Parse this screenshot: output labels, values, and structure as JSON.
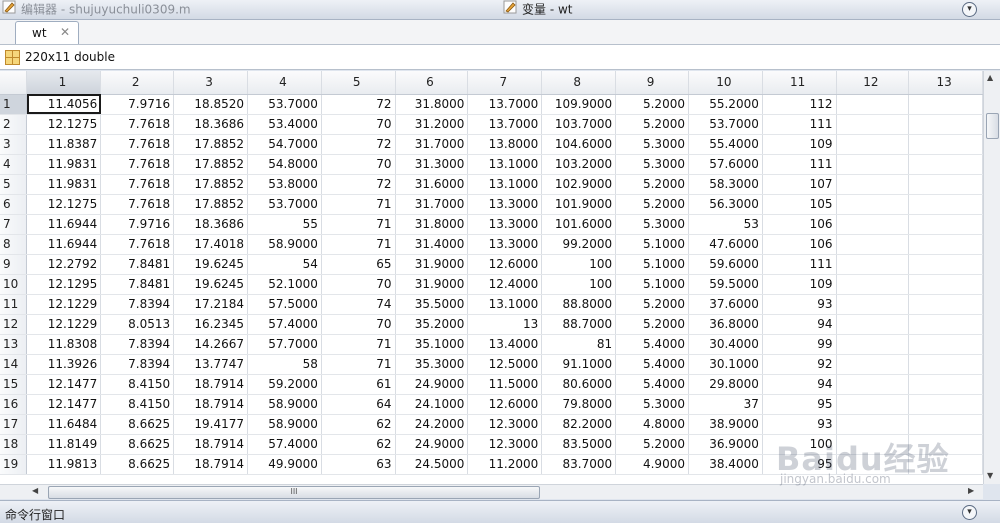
{
  "titlebar": {
    "editor_title": "编辑器 - shujuyuchuli0309.m",
    "variables_title": "变量 - wt"
  },
  "tabs": [
    {
      "label": "wt",
      "close": "✕"
    }
  ],
  "info": {
    "dimensions": "220x11 double"
  },
  "grid": {
    "columns": [
      "1",
      "2",
      "3",
      "4",
      "5",
      "6",
      "7",
      "8",
      "9",
      "10",
      "11",
      "12",
      "13"
    ],
    "rows": [
      {
        "n": "1",
        "cells": [
          "11.4056",
          "7.9716",
          "18.8520",
          "53.7000",
          "72",
          "31.8000",
          "13.7000",
          "109.9000",
          "5.2000",
          "55.2000",
          "112",
          "",
          ""
        ]
      },
      {
        "n": "2",
        "cells": [
          "12.1275",
          "7.7618",
          "18.3686",
          "53.4000",
          "70",
          "31.2000",
          "13.7000",
          "103.7000",
          "5.2000",
          "53.7000",
          "111",
          "",
          ""
        ]
      },
      {
        "n": "3",
        "cells": [
          "11.8387",
          "7.7618",
          "17.8852",
          "54.7000",
          "72",
          "31.7000",
          "13.8000",
          "104.6000",
          "5.3000",
          "55.4000",
          "109",
          "",
          ""
        ]
      },
      {
        "n": "4",
        "cells": [
          "11.9831",
          "7.7618",
          "17.8852",
          "54.8000",
          "70",
          "31.3000",
          "13.1000",
          "103.2000",
          "5.3000",
          "57.6000",
          "111",
          "",
          ""
        ]
      },
      {
        "n": "5",
        "cells": [
          "11.9831",
          "7.7618",
          "17.8852",
          "53.8000",
          "72",
          "31.6000",
          "13.1000",
          "102.9000",
          "5.2000",
          "58.3000",
          "107",
          "",
          ""
        ]
      },
      {
        "n": "6",
        "cells": [
          "12.1275",
          "7.7618",
          "17.8852",
          "53.7000",
          "71",
          "31.7000",
          "13.3000",
          "101.9000",
          "5.2000",
          "56.3000",
          "105",
          "",
          ""
        ]
      },
      {
        "n": "7",
        "cells": [
          "11.6944",
          "7.9716",
          "18.3686",
          "55",
          "71",
          "31.8000",
          "13.3000",
          "101.6000",
          "5.3000",
          "53",
          "106",
          "",
          ""
        ]
      },
      {
        "n": "8",
        "cells": [
          "11.6944",
          "7.7618",
          "17.4018",
          "58.9000",
          "71",
          "31.4000",
          "13.3000",
          "99.2000",
          "5.1000",
          "47.6000",
          "106",
          "",
          ""
        ]
      },
      {
        "n": "9",
        "cells": [
          "12.2792",
          "7.8481",
          "19.6245",
          "54",
          "65",
          "31.9000",
          "12.6000",
          "100",
          "5.1000",
          "59.6000",
          "111",
          "",
          ""
        ]
      },
      {
        "n": "10",
        "cells": [
          "12.1295",
          "7.8481",
          "19.6245",
          "52.1000",
          "70",
          "31.9000",
          "12.4000",
          "100",
          "5.1000",
          "59.5000",
          "109",
          "",
          ""
        ]
      },
      {
        "n": "11",
        "cells": [
          "12.1229",
          "7.8394",
          "17.2184",
          "57.5000",
          "74",
          "35.5000",
          "13.1000",
          "88.8000",
          "5.2000",
          "37.6000",
          "93",
          "",
          ""
        ]
      },
      {
        "n": "12",
        "cells": [
          "12.1229",
          "8.0513",
          "16.2345",
          "57.4000",
          "70",
          "35.2000",
          "13",
          "88.7000",
          "5.2000",
          "36.8000",
          "94",
          "",
          ""
        ]
      },
      {
        "n": "13",
        "cells": [
          "11.8308",
          "7.8394",
          "14.2667",
          "57.7000",
          "71",
          "35.1000",
          "13.4000",
          "81",
          "5.4000",
          "30.4000",
          "99",
          "",
          ""
        ]
      },
      {
        "n": "14",
        "cells": [
          "11.3926",
          "7.8394",
          "13.7747",
          "58",
          "71",
          "35.3000",
          "12.5000",
          "91.1000",
          "5.4000",
          "30.1000",
          "92",
          "",
          ""
        ]
      },
      {
        "n": "15",
        "cells": [
          "12.1477",
          "8.4150",
          "18.7914",
          "59.2000",
          "61",
          "24.9000",
          "11.5000",
          "80.6000",
          "5.4000",
          "29.8000",
          "94",
          "",
          ""
        ]
      },
      {
        "n": "16",
        "cells": [
          "12.1477",
          "8.4150",
          "18.7914",
          "58.9000",
          "64",
          "24.1000",
          "12.6000",
          "79.8000",
          "5.3000",
          "37",
          "95",
          "",
          ""
        ]
      },
      {
        "n": "17",
        "cells": [
          "11.6484",
          "8.6625",
          "19.4177",
          "58.9000",
          "62",
          "24.2000",
          "12.3000",
          "82.2000",
          "4.8000",
          "38.9000",
          "93",
          "",
          ""
        ]
      },
      {
        "n": "18",
        "cells": [
          "11.8149",
          "8.6625",
          "18.7914",
          "57.4000",
          "62",
          "24.9000",
          "12.3000",
          "83.5000",
          "5.2000",
          "36.9000",
          "100",
          "",
          ""
        ]
      },
      {
        "n": "19",
        "cells": [
          "11.9813",
          "8.6625",
          "18.7914",
          "49.9000",
          "63",
          "24.5000",
          "11.2000",
          "83.7000",
          "4.9000",
          "38.4000",
          "95",
          "",
          ""
        ]
      }
    ]
  },
  "scroll": {
    "h_grip": "III"
  },
  "bottom": {
    "command_window_label": "命令行窗口"
  },
  "watermark": {
    "text": "Baidu经验",
    "url": "jingyan.baidu.com"
  }
}
